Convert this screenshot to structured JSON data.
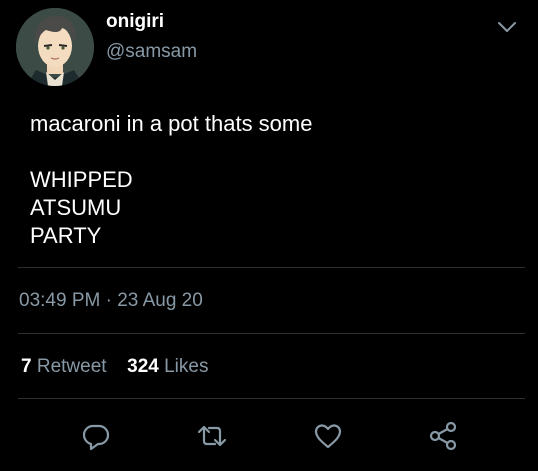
{
  "user": {
    "display_name": "onigiri",
    "handle": "@samsam"
  },
  "tweet": {
    "lines": [
      "macaroni in a pot thats some",
      "",
      "WHIPPED",
      "ATSUMU",
      "PARTY"
    ],
    "timestamp": "03:49 PM · 23 Aug 20"
  },
  "stats": {
    "retweets_count": "7",
    "retweets_label": "Retweet",
    "likes_count": "324",
    "likes_label": "Likes"
  },
  "icons": {
    "caret": "chevron-down-icon",
    "reply": "reply-icon",
    "retweet": "retweet-icon",
    "like": "heart-icon",
    "share": "share-icon"
  },
  "colors": {
    "background": "#000000",
    "text_primary": "#ffffff",
    "text_secondary": "#8899a6",
    "divider": "#2a2f33"
  }
}
